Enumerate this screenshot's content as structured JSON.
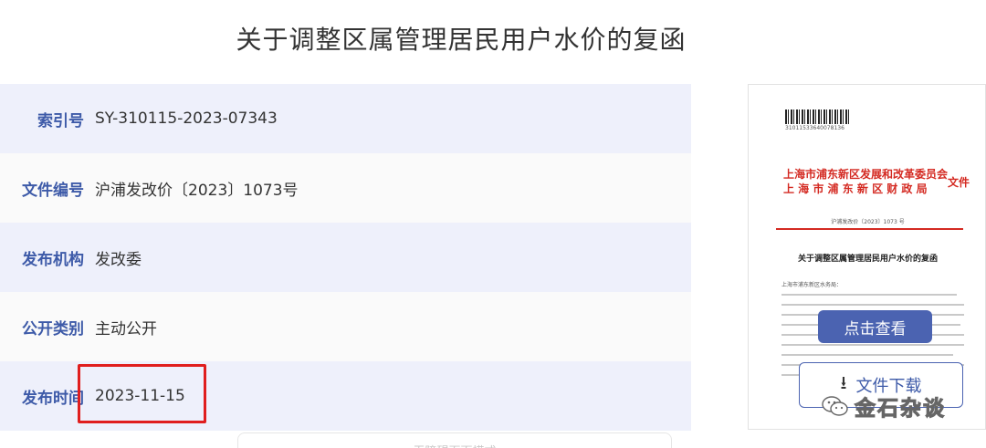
{
  "title": "关于调整区属管理居民用户水价的复函",
  "meta": [
    {
      "label": "索引号",
      "value": "SY-310115-2023-07343"
    },
    {
      "label": "文件编号",
      "value": "沪浦发改价〔2023〕1073号"
    },
    {
      "label": "发布机构",
      "value": "发改委"
    },
    {
      "label": "公开类别",
      "value": "主动公开"
    },
    {
      "label": "发布时间",
      "value": "2023-11-15"
    }
  ],
  "ghost_bar_text": "无障碍页面模式",
  "preview": {
    "barcode_number": "31011533640078136",
    "org_line1": "上海市浦东新区发展和改革委员会",
    "org_line2": "上 海 市 浦 东 新 区 财 政 局",
    "org_suffix": "文件",
    "doc_no": "沪浦发改价〔2023〕1073 号",
    "subject": "关于调整区属管理居民用户水价的复函",
    "addressee": "上海市浦东新区水务局："
  },
  "view_button_label": "点击查看",
  "download_button_label": "文件下载",
  "watermark_text": "金石杂谈",
  "colors": {
    "accent": "#4b63b1",
    "label_blue": "#3d5aa8",
    "row_tint": "#eef0fb",
    "highlight_red": "#e01e1e",
    "doc_red": "#d42a22"
  }
}
